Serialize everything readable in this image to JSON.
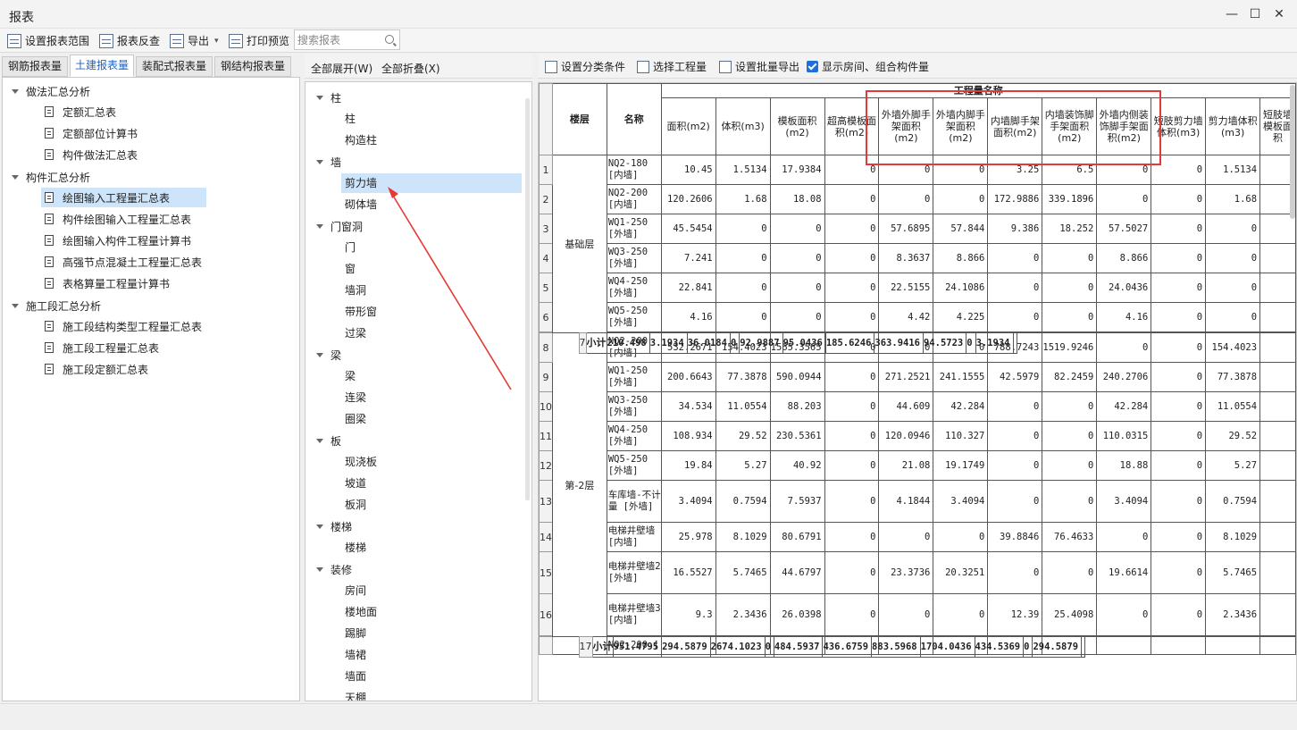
{
  "window": {
    "title": "报表"
  },
  "toolbar": {
    "set_range": "设置报表范围",
    "reverse_check": "报表反查",
    "export": "导出",
    "print_preview": "打印预览",
    "search_placeholder": "搜索报表"
  },
  "tabs": [
    "钢筋报表量",
    "土建报表量",
    "装配式报表量",
    "钢结构报表量"
  ],
  "active_tab": 1,
  "left_tree": {
    "groups": [
      {
        "label": "做法汇总分析",
        "items": [
          "定额汇总表",
          "定额部位计算书",
          "构件做法汇总表"
        ]
      },
      {
        "label": "构件汇总分析",
        "items": [
          "绘图输入工程量汇总表",
          "构件绘图输入工程量汇总表",
          "绘图输入构件工程量计算书",
          "高强节点混凝土工程量汇总表",
          "表格算量工程量计算书"
        ]
      },
      {
        "label": "施工段汇总分析",
        "items": [
          "施工段结构类型工程量汇总表",
          "施工段工程量汇总表",
          "施工段定额汇总表"
        ]
      }
    ],
    "selected": "绘图输入工程量汇总表"
  },
  "mid_panel": {
    "expand_all": "全部展开(W)",
    "collapse_all": "全部折叠(X)",
    "categories": [
      {
        "label": "柱",
        "items": [
          "柱",
          "构造柱"
        ]
      },
      {
        "label": "墙",
        "items": [
          "剪力墙",
          "砌体墙"
        ]
      },
      {
        "label": "门窗洞",
        "items": [
          "门",
          "窗",
          "墙洞",
          "带形窗",
          "过梁"
        ]
      },
      {
        "label": "梁",
        "items": [
          "梁",
          "连梁",
          "圈梁"
        ]
      },
      {
        "label": "板",
        "items": [
          "现浇板",
          "坡道",
          "板洞"
        ]
      },
      {
        "label": "楼梯",
        "items": [
          "楼梯"
        ]
      },
      {
        "label": "装修",
        "items": [
          "房间",
          "楼地面",
          "踢脚",
          "墙裙",
          "墙面",
          "天棚"
        ]
      }
    ],
    "selected": "剪力墙"
  },
  "right_toolbar": {
    "set_category": "设置分类条件",
    "select_qty": "选择工程量",
    "batch_export": "设置批量导出",
    "show_rooms": "显示房间、组合构件量"
  },
  "grid": {
    "col_floor": "楼层",
    "col_name": "名称",
    "group_header": "工程量名称",
    "columns": [
      "面积(m2)",
      "体积(m3)",
      "模板面积(m2)",
      "超高模板面积(m2)",
      "外墙外脚手架面积(m2)",
      "外墙内脚手架面积(m2)",
      "内墙脚手架面积(m2)",
      "内墙装饰脚手架面积(m2)",
      "外墙内侧装饰脚手架面积(m2)",
      "短肢剪力墙体积(m3)",
      "剪力墙体积(m3)",
      "短肢墙模板面积"
    ],
    "rows": [
      {
        "n": "1",
        "floor": "基础层",
        "name": "NQ2-180 [内墙]",
        "v": [
          "10.45",
          "1.5134",
          "17.9384",
          "0",
          "0",
          "0",
          "3.25",
          "6.5",
          "0",
          "0",
          "1.5134",
          ""
        ]
      },
      {
        "n": "2",
        "name": "NQ2-200 [内墙]",
        "v": [
          "120.2606",
          "1.68",
          "18.08",
          "0",
          "0",
          "0",
          "172.9886",
          "339.1896",
          "0",
          "0",
          "1.68",
          ""
        ]
      },
      {
        "n": "3",
        "name": "WQ1-250 [外墙]",
        "v": [
          "45.5454",
          "0",
          "0",
          "0",
          "57.6895",
          "57.844",
          "9.386",
          "18.252",
          "57.5027",
          "0",
          "0",
          ""
        ]
      },
      {
        "n": "4",
        "name": "WQ3-250 [外墙]",
        "v": [
          "7.241",
          "0",
          "0",
          "0",
          "8.3637",
          "8.866",
          "0",
          "0",
          "8.866",
          "0",
          "0",
          ""
        ]
      },
      {
        "n": "5",
        "name": "WQ4-250 [外墙]",
        "v": [
          "22.841",
          "0",
          "0",
          "0",
          "22.5155",
          "24.1086",
          "0",
          "0",
          "24.0436",
          "0",
          "0",
          ""
        ]
      },
      {
        "n": "6",
        "name": "WQ5-250 [外墙]",
        "v": [
          "4.16",
          "0",
          "0",
          "0",
          "4.42",
          "4.225",
          "0",
          "0",
          "4.16",
          "0",
          "0",
          ""
        ]
      },
      {
        "n": "7",
        "subtotal": "小计",
        "v": [
          "210.498",
          "3.1934",
          "36.0184",
          "0",
          "92.9887",
          "95.0436",
          "185.6246",
          "363.9416",
          "94.5723",
          "0",
          "3.1934",
          ""
        ]
      },
      {
        "n": "8",
        "floor": "第-2层",
        "name": "NQ2-200 [内墙]",
        "v": [
          "532.2671",
          "154.4023",
          "1565.3565",
          "0",
          "0",
          "0",
          "788.7243",
          "1519.9246",
          "0",
          "0",
          "154.4023",
          ""
        ]
      },
      {
        "n": "9",
        "name": "WQ1-250 [外墙]",
        "v": [
          "200.6643",
          "77.3878",
          "590.0944",
          "0",
          "271.2521",
          "241.1555",
          "42.5979",
          "82.2459",
          "240.2706",
          "0",
          "77.3878",
          ""
        ]
      },
      {
        "n": "10",
        "name": "WQ3-250 [外墙]",
        "v": [
          "34.534",
          "11.0554",
          "88.203",
          "0",
          "44.609",
          "42.284",
          "0",
          "0",
          "42.284",
          "0",
          "11.0554",
          ""
        ]
      },
      {
        "n": "11",
        "name": "WQ4-250 [外墙]",
        "v": [
          "108.934",
          "29.52",
          "230.5361",
          "0",
          "120.0946",
          "110.327",
          "0",
          "0",
          "110.0315",
          "0",
          "29.52",
          ""
        ]
      },
      {
        "n": "12",
        "name": "WQ5-250 [外墙]",
        "v": [
          "19.84",
          "5.27",
          "40.92",
          "0",
          "21.08",
          "19.1749",
          "0",
          "0",
          "18.88",
          "0",
          "5.27",
          ""
        ]
      },
      {
        "n": "13",
        "name": "车库墙-不计量 [外墙]",
        "v": [
          "3.4094",
          "0.7594",
          "7.5937",
          "0",
          "4.1844",
          "3.4094",
          "0",
          "0",
          "3.4094",
          "0",
          "0.7594",
          ""
        ]
      },
      {
        "n": "14",
        "name": "电梯井壁墙 [内墙]",
        "v": [
          "25.978",
          "8.1029",
          "80.6791",
          "0",
          "0",
          "0",
          "39.8846",
          "76.4633",
          "0",
          "0",
          "8.1029",
          ""
        ]
      },
      {
        "n": "15",
        "name": "电梯井壁墙2 [外墙]",
        "v": [
          "16.5527",
          "5.7465",
          "44.6797",
          "0",
          "23.3736",
          "20.3251",
          "0",
          "0",
          "19.6614",
          "0",
          "5.7465",
          ""
        ]
      },
      {
        "n": "16",
        "name": "电梯井壁墙3 [内墙]",
        "v": [
          "9.3",
          "2.3436",
          "26.0398",
          "0",
          "0",
          "0",
          "12.39",
          "25.4098",
          "0",
          "0",
          "2.3436",
          ""
        ]
      },
      {
        "n": "17",
        "subtotal": "小计",
        "v": [
          "951.4795",
          "294.5879",
          "2674.1023",
          "0",
          "484.5937",
          "436.6759",
          "883.5968",
          "1704.0436",
          "434.5369",
          "0",
          "294.5879",
          ""
        ]
      },
      {
        "n": "",
        "name": "NQ2-200 [",
        "v": [
          "",
          "",
          "",
          "",
          "",
          "",
          "",
          "",
          "",
          "",
          "",
          ""
        ]
      }
    ]
  },
  "annotation": {
    "box_color": "#e53935",
    "arrow_color": "#e53935"
  },
  "colors": {
    "accent": "#1e64c8",
    "selection": "#cde4fa"
  }
}
